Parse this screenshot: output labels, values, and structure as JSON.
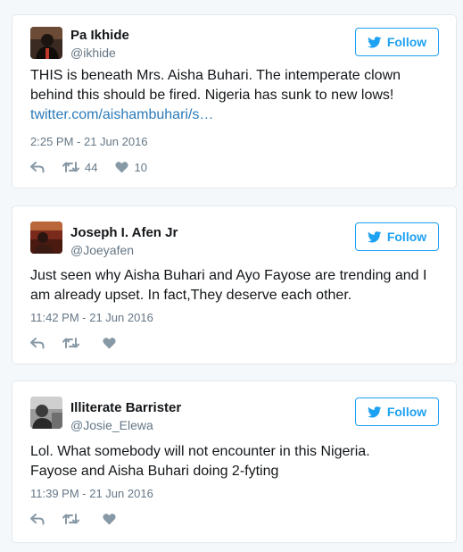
{
  "tweets": [
    {
      "name": "Pa Ikhide",
      "handle": "@ikhide",
      "follow_label": "Follow",
      "lines": [
        "THIS is beneath Mrs. Aisha Buhari. The intemperate clown",
        "behind this should be fired. Nigeria has sunk to new lows!"
      ],
      "link": "twitter.com/aishambuhari/s…",
      "time": "2:25 PM - 21 Jun 2016",
      "retweets": "44",
      "likes": "10"
    },
    {
      "name": "Joseph I. Afen Jr",
      "handle": "@Joeyafen",
      "follow_label": "Follow",
      "lines": [
        "Just seen why Aisha Buhari and Ayo Fayose are trending and I",
        "am already upset. In fact,They deserve each other."
      ],
      "time": "11:42 PM - 21 Jun 2016"
    },
    {
      "name": "Illiterate Barrister",
      "handle": "@Josie_Elewa",
      "follow_label": "Follow",
      "lines": [
        "Lol. What somebody will not encounter in this Nigeria.",
        "Fayose and Aisha Buhari doing 2-fyting"
      ],
      "time": "11:39 PM - 21 Jun 2016"
    }
  ],
  "icons": {
    "follow": "twitter-bird-icon",
    "reply": "reply-icon",
    "retweet": "retweet-icon",
    "like": "heart-icon"
  },
  "colors": {
    "accent": "#1da1f2",
    "link": "#2b7bb9",
    "muted": "#657786",
    "text": "#14171a",
    "background": "#f5f8fa",
    "border": "#e1e8ed"
  }
}
